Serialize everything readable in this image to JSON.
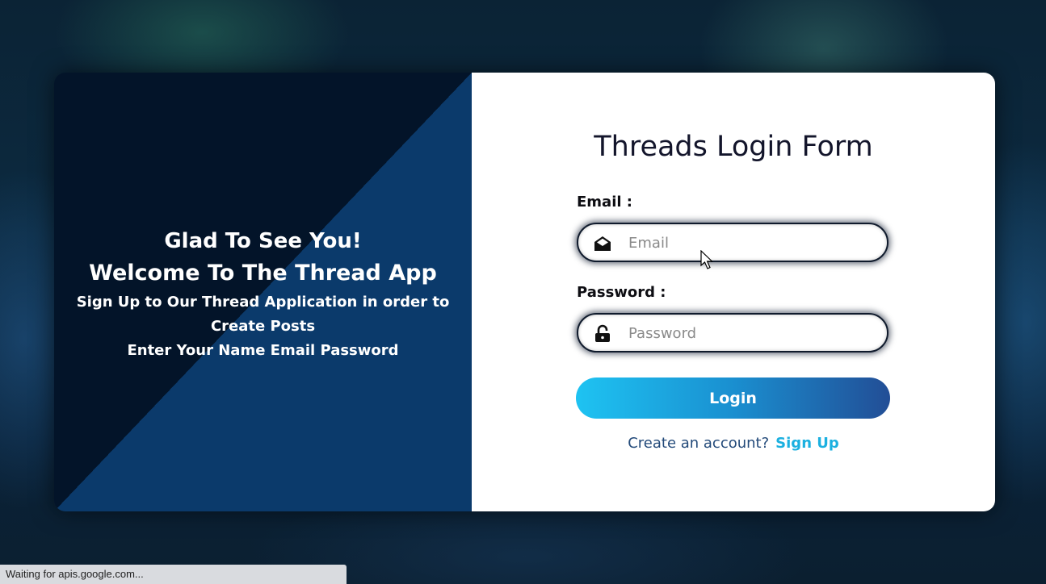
{
  "left_panel": {
    "line1": "Glad To See You!",
    "line2": "Welcome To The Thread App",
    "line3": "Sign Up to Our Thread Application in order to Create Posts",
    "line4": "Enter Your Name Email Password"
  },
  "form": {
    "title": "Threads Login Form",
    "email_label": "Email :",
    "email_placeholder": "Email",
    "email_value": "",
    "password_label": "Password :",
    "password_placeholder": "Password",
    "password_value": "",
    "login_label": "Login",
    "create_text": "Create an account?",
    "signup_label": "Sign Up"
  },
  "icons": {
    "email": "envelope-open-icon",
    "password": "lock-open-icon"
  },
  "colors": {
    "login_gradient_start": "#1ec3f2",
    "login_gradient_end": "#224e96",
    "signup_link": "#1bb0e0",
    "left_dark": "#031429",
    "left_light": "#0b3a6b"
  },
  "status_bar": {
    "text": "Waiting for apis.google.com..."
  }
}
